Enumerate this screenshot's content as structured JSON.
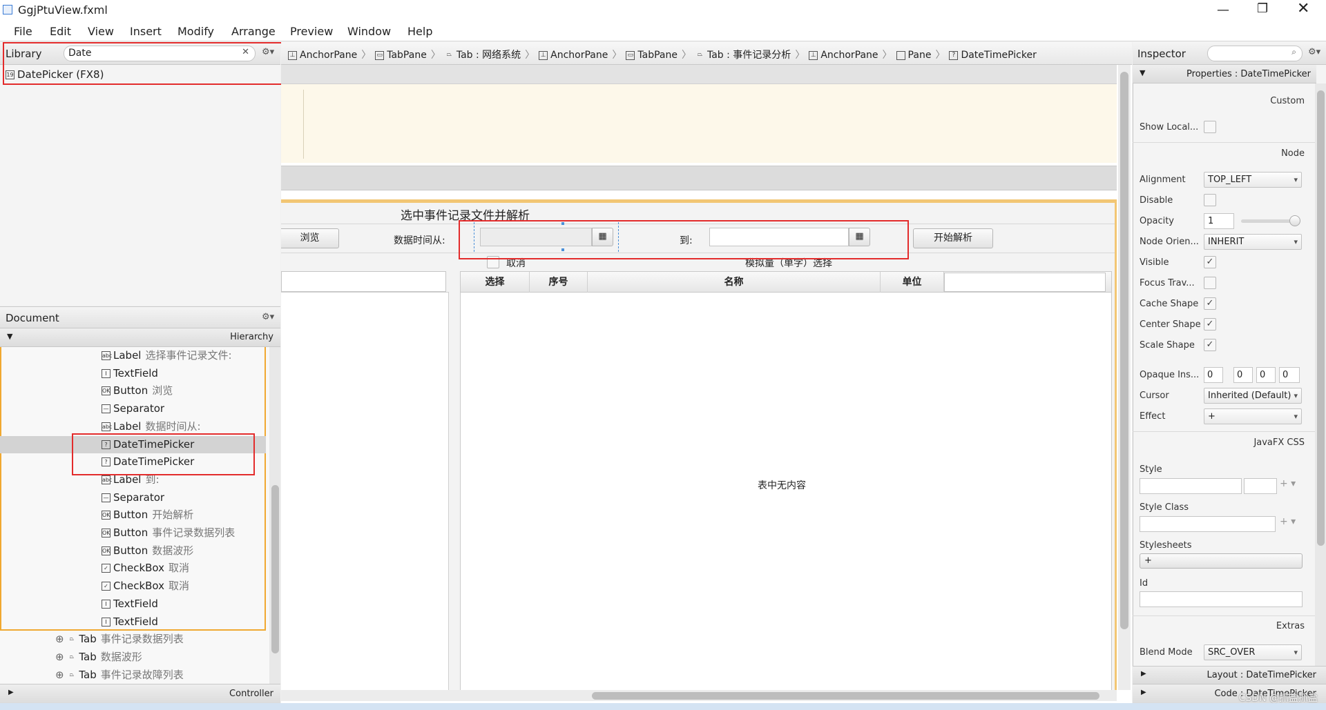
{
  "window": {
    "title": "GgjPtuView.fxml"
  },
  "menu": [
    "File",
    "Edit",
    "View",
    "Insert",
    "Modify",
    "Arrange",
    "Preview",
    "Window",
    "Help"
  ],
  "library": {
    "title": "Library",
    "search_value": "Date",
    "result": "DatePicker  (FX8)"
  },
  "document": {
    "title": "Document",
    "hierarchy_label": "Hierarchy",
    "controller_label": "Controller",
    "items": [
      {
        "icon": "abc",
        "name": "Label",
        "sub": "选择事件记录文件:",
        "level": 2
      },
      {
        "icon": "I",
        "name": "TextField",
        "sub": "",
        "level": 2
      },
      {
        "icon": "OK",
        "name": "Button",
        "sub": "浏览",
        "level": 2
      },
      {
        "icon": "—",
        "name": "Separator",
        "sub": "",
        "level": 2
      },
      {
        "icon": "abc",
        "name": "Label",
        "sub": "数据时间从:",
        "level": 2
      },
      {
        "icon": "?",
        "name": "DateTimePicker",
        "sub": "",
        "level": 2,
        "selected": true
      },
      {
        "icon": "?",
        "name": "DateTimePicker",
        "sub": "",
        "level": 2
      },
      {
        "icon": "abc",
        "name": "Label",
        "sub": "到:",
        "level": 2
      },
      {
        "icon": "—",
        "name": "Separator",
        "sub": "",
        "level": 2
      },
      {
        "icon": "OK",
        "name": "Button",
        "sub": "开始解析",
        "level": 2
      },
      {
        "icon": "OK",
        "name": "Button",
        "sub": "事件记录数据列表",
        "level": 2
      },
      {
        "icon": "OK",
        "name": "Button",
        "sub": "数据波形",
        "level": 2
      },
      {
        "icon": "✓",
        "name": "CheckBox",
        "sub": "取消",
        "level": 2
      },
      {
        "icon": "✓",
        "name": "CheckBox",
        "sub": "取消",
        "level": 2
      },
      {
        "icon": "I",
        "name": "TextField",
        "sub": "",
        "level": 2
      },
      {
        "icon": "I",
        "name": "TextField",
        "sub": "",
        "level": 2
      },
      {
        "icon": "⊕",
        "name": "Tab",
        "sub": "事件记录数据列表",
        "level": 1
      },
      {
        "icon": "⊕",
        "name": "Tab",
        "sub": "数据波形",
        "level": 1
      },
      {
        "icon": "⊕",
        "name": "Tab",
        "sub": "事件记录故障列表",
        "level": 1
      }
    ]
  },
  "breadcrumb": [
    "AnchorPane",
    "TabPane",
    "Tab : 网络系统",
    "AnchorPane",
    "TabPane",
    "Tab : 事件记录分析",
    "AnchorPane",
    "Pane",
    "DateTimePicker"
  ],
  "canvas": {
    "section_title": "选中事件记录文件并解析",
    "browse_button": "浏览",
    "from_label": "数据时间从:",
    "to_label": "到:",
    "start_button": "开始解析",
    "cancel_checkbox": "取消",
    "analog_label": "模拟量（单字）选择",
    "table_headers": [
      "选择",
      "序号",
      "名称",
      "单位"
    ],
    "table_empty": "表中无内容"
  },
  "inspector": {
    "title": "Inspector",
    "properties_label": "Properties : DateTimePicker",
    "sections": {
      "custom": "Custom",
      "node": "Node",
      "css": "JavaFX CSS",
      "extras": "Extras"
    },
    "props": {
      "show_local": "Show Local...",
      "alignment": "Alignment",
      "alignment_value": "TOP_LEFT",
      "disable": "Disable",
      "opacity": "Opacity",
      "opacity_value": "1",
      "node_orientation": "Node Orien...",
      "node_orientation_value": "INHERIT",
      "visible": "Visible",
      "focus_traversable": "Focus Trav...",
      "cache_shape": "Cache Shape",
      "center_shape": "Center Shape",
      "scale_shape": "Scale Shape",
      "opaque_insets": "Opaque Ins...",
      "opaque_values": [
        "0",
        "0",
        "0",
        "0"
      ],
      "cursor": "Cursor",
      "cursor_value": "Inherited (Default)",
      "effect": "Effect",
      "effect_value": "+",
      "style": "Style",
      "style_class": "Style Class",
      "stylesheets": "Stylesheets",
      "stylesheets_add": "+",
      "id": "Id",
      "blend_mode": "Blend Mode",
      "blend_mode_value": "SRC_OVER"
    },
    "layout_label": "Layout : DateTimePicker",
    "code_label": "Code : DateTimePicker",
    "watermark": "CSDN @抓盐抓盐"
  }
}
